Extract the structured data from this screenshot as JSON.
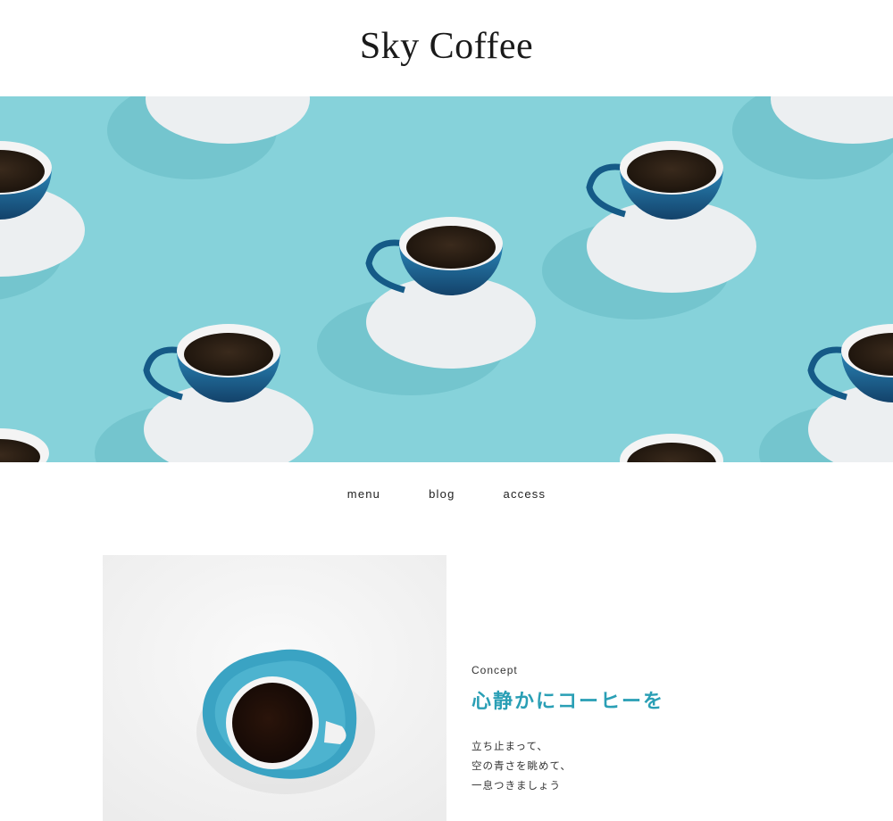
{
  "header": {
    "logo": "Sky Coffee"
  },
  "hero": {
    "background_color": "#86d2da",
    "cup_color": "#1e6fa0",
    "saucer_color": "#e9eef0"
  },
  "nav": {
    "items": [
      {
        "label": "menu"
      },
      {
        "label": "blog"
      },
      {
        "label": "access"
      }
    ]
  },
  "concept": {
    "label": "Concept",
    "heading": "心静かにコーヒーを",
    "body": [
      "立ち止まって、",
      "空の青さを眺めて、",
      "一息つきましょう"
    ],
    "accent_color": "#2a9fb5"
  }
}
